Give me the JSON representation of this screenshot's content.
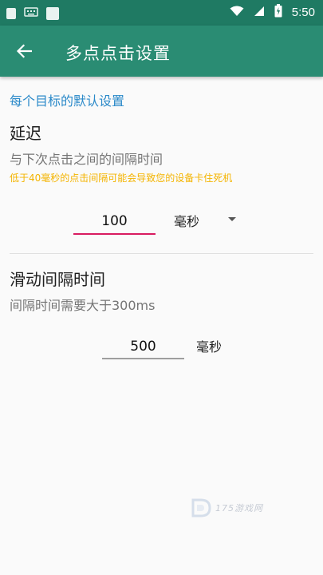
{
  "status_bar": {
    "time": "5:50",
    "icons": [
      "notification-icon",
      "keyboard-icon",
      "app-icon",
      "wifi-icon",
      "signal-icon",
      "battery-icon"
    ]
  },
  "app_bar": {
    "title": "多点点击设置",
    "back_icon": "arrow-left-icon"
  },
  "section": {
    "title": "每个目标的默认设置"
  },
  "delay": {
    "title": "延迟",
    "subtitle": "与下次点击之间的间隔时间",
    "warning": "低于40毫秒的点击间隔可能会导致您的设备卡住死机",
    "value": "100",
    "unit": "毫秒"
  },
  "slide": {
    "title": "滑动间隔时间",
    "subtitle": "间隔时间需要大于300ms",
    "value": "500",
    "unit": "毫秒"
  },
  "watermark": {
    "text": "175游戏网"
  },
  "colors": {
    "status_bar": "#1f7a63",
    "app_bar": "#2a8c73",
    "section_title": "#2a89c9",
    "warning": "#f4b400",
    "focus_underline": "#d81b60"
  }
}
